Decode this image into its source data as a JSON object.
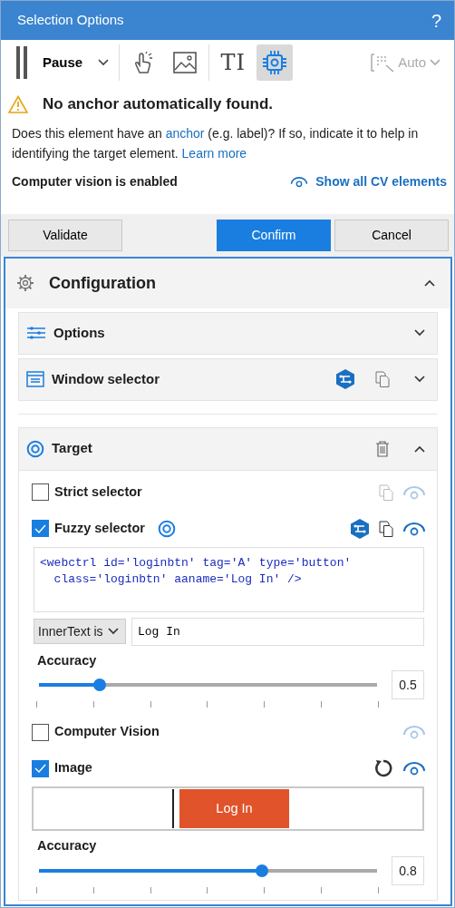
{
  "window": {
    "title": "Selection Options",
    "help": "?"
  },
  "toolbar": {
    "pause": {
      "label": "Pause"
    },
    "tools": [
      {
        "kind": "tap",
        "selected": false
      },
      {
        "kind": "image",
        "selected": false
      },
      {
        "kind": "text",
        "label": "TI",
        "selected": false
      },
      {
        "kind": "chip",
        "selected": true
      }
    ],
    "auto": {
      "label": "Auto",
      "disabled": true
    }
  },
  "warning": {
    "title": "No anchor automatically found.",
    "text_before": "Does this element have an ",
    "anchor_link": "anchor",
    "text_after": " (e.g. label)? If so, indicate it to help in identifying the target element. ",
    "learn_more_link": "Learn more"
  },
  "cv": {
    "status": "Computer vision is enabled",
    "link": "Show all CV elements"
  },
  "buttons": [
    {
      "label": "Validate",
      "primary": false
    },
    {
      "label": "Confirm",
      "primary": true
    },
    {
      "label": "Cancel",
      "primary": false
    }
  ],
  "configuration": {
    "title": "Configuration",
    "expanded": true,
    "sections": [
      {
        "kind": "options",
        "title": "Options",
        "expanded": false
      },
      {
        "kind": "window",
        "title": "Window selector",
        "expanded": false
      },
      {
        "kind": "target",
        "title": "Target",
        "expanded": true
      }
    ]
  },
  "target": {
    "rows": [
      {
        "kind": "strict",
        "label": "Strict selector",
        "checked": false
      },
      {
        "kind": "fuzzy",
        "label": "Fuzzy selector",
        "checked": true,
        "code": "<webctrl id='loginbtn' tag='A' type='button'\n  class='loginbtn' aaname='Log In' />",
        "match": {
          "operator": "InnerText is",
          "value": "Log In"
        },
        "accuracy": {
          "label": "Accuracy",
          "level": 0.18,
          "reading": "0.5"
        }
      },
      {
        "kind": "cv",
        "label": "Computer Vision",
        "checked": false
      },
      {
        "kind": "image",
        "label": "Image",
        "checked": true,
        "preview": {
          "button": "Log In"
        },
        "accuracy": {
          "label": "Accuracy",
          "level": 0.66,
          "reading": "0.8"
        }
      }
    ]
  }
}
